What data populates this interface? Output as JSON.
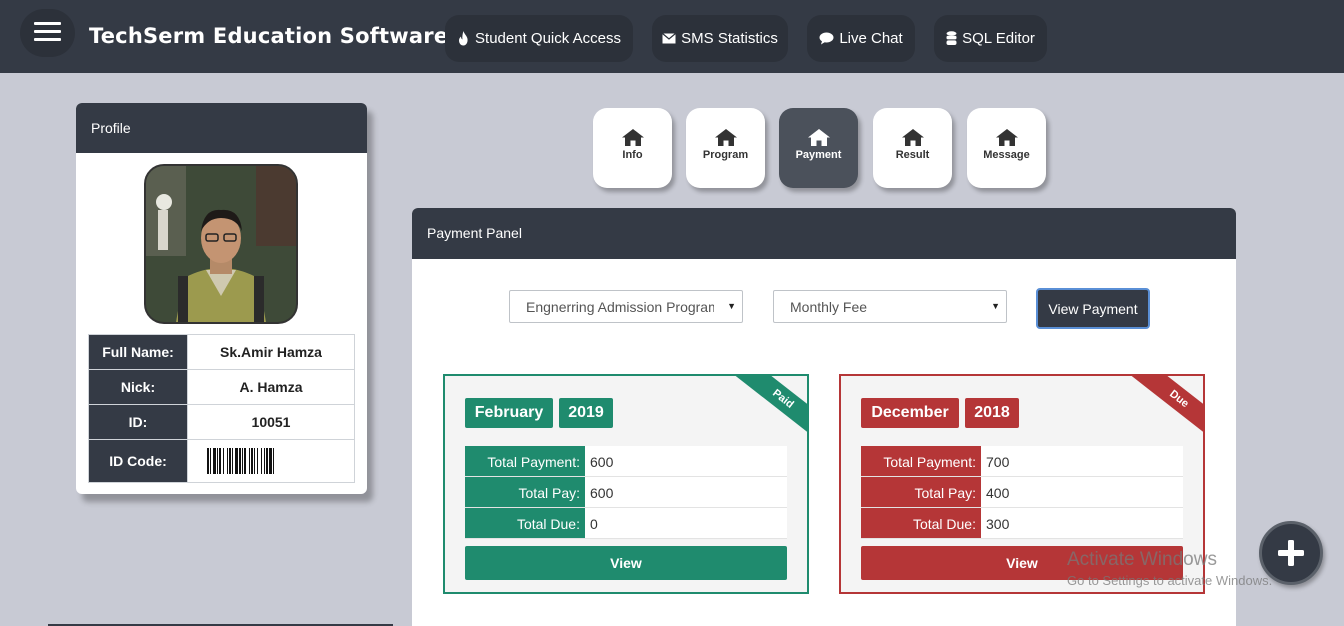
{
  "header": {
    "title": "TechSerm Education Software",
    "nav": [
      {
        "label": "Student Quick Access",
        "icon": "fire-icon"
      },
      {
        "label": "SMS Statistics",
        "icon": "envelope-icon"
      },
      {
        "label": "Live Chat",
        "icon": "chat-icon"
      },
      {
        "label": "SQL Editor",
        "icon": "database-icon"
      }
    ]
  },
  "profile": {
    "heading": "Profile",
    "rows": [
      {
        "label": "Full Name:",
        "value": "Sk.Amir Hamza"
      },
      {
        "label": "Nick:",
        "value": "A. Hamza"
      },
      {
        "label": "ID:",
        "value": "10051"
      },
      {
        "label": "ID Code:",
        "value": ""
      }
    ]
  },
  "tabs": [
    {
      "label": "Info",
      "icon": "home-icon",
      "active": false
    },
    {
      "label": "Program",
      "icon": "home-icon",
      "active": false
    },
    {
      "label": "Payment",
      "icon": "home-icon",
      "active": true
    },
    {
      "label": "Result",
      "icon": "home-icon",
      "active": false
    },
    {
      "label": "Message",
      "icon": "home-icon",
      "active": false
    }
  ],
  "payment_panel": {
    "heading": "Payment Panel",
    "program_select": "Engnerring Admission Program",
    "fee_select": "Monthly Fee",
    "view_button": "View Payment",
    "cards": [
      {
        "status": "Paid",
        "month": "February",
        "year": "2019",
        "color": "#1f8b6e",
        "rows": [
          {
            "label": "Total Payment:",
            "value": "600"
          },
          {
            "label": "Total Pay:",
            "value": "600"
          },
          {
            "label": "Total Due:",
            "value": "0"
          }
        ],
        "button": "View"
      },
      {
        "status": "Due",
        "month": "December",
        "year": "2018",
        "color": "#b53637",
        "rows": [
          {
            "label": "Total Payment:",
            "value": "700"
          },
          {
            "label": "Total Pay:",
            "value": "400"
          },
          {
            "label": "Total Due:",
            "value": "300"
          }
        ],
        "button": "View"
      }
    ]
  },
  "watermark": {
    "line1": "Activate Windows",
    "line2": "Go to Settings to activate Windows."
  },
  "fab_icon": "plus-icon"
}
